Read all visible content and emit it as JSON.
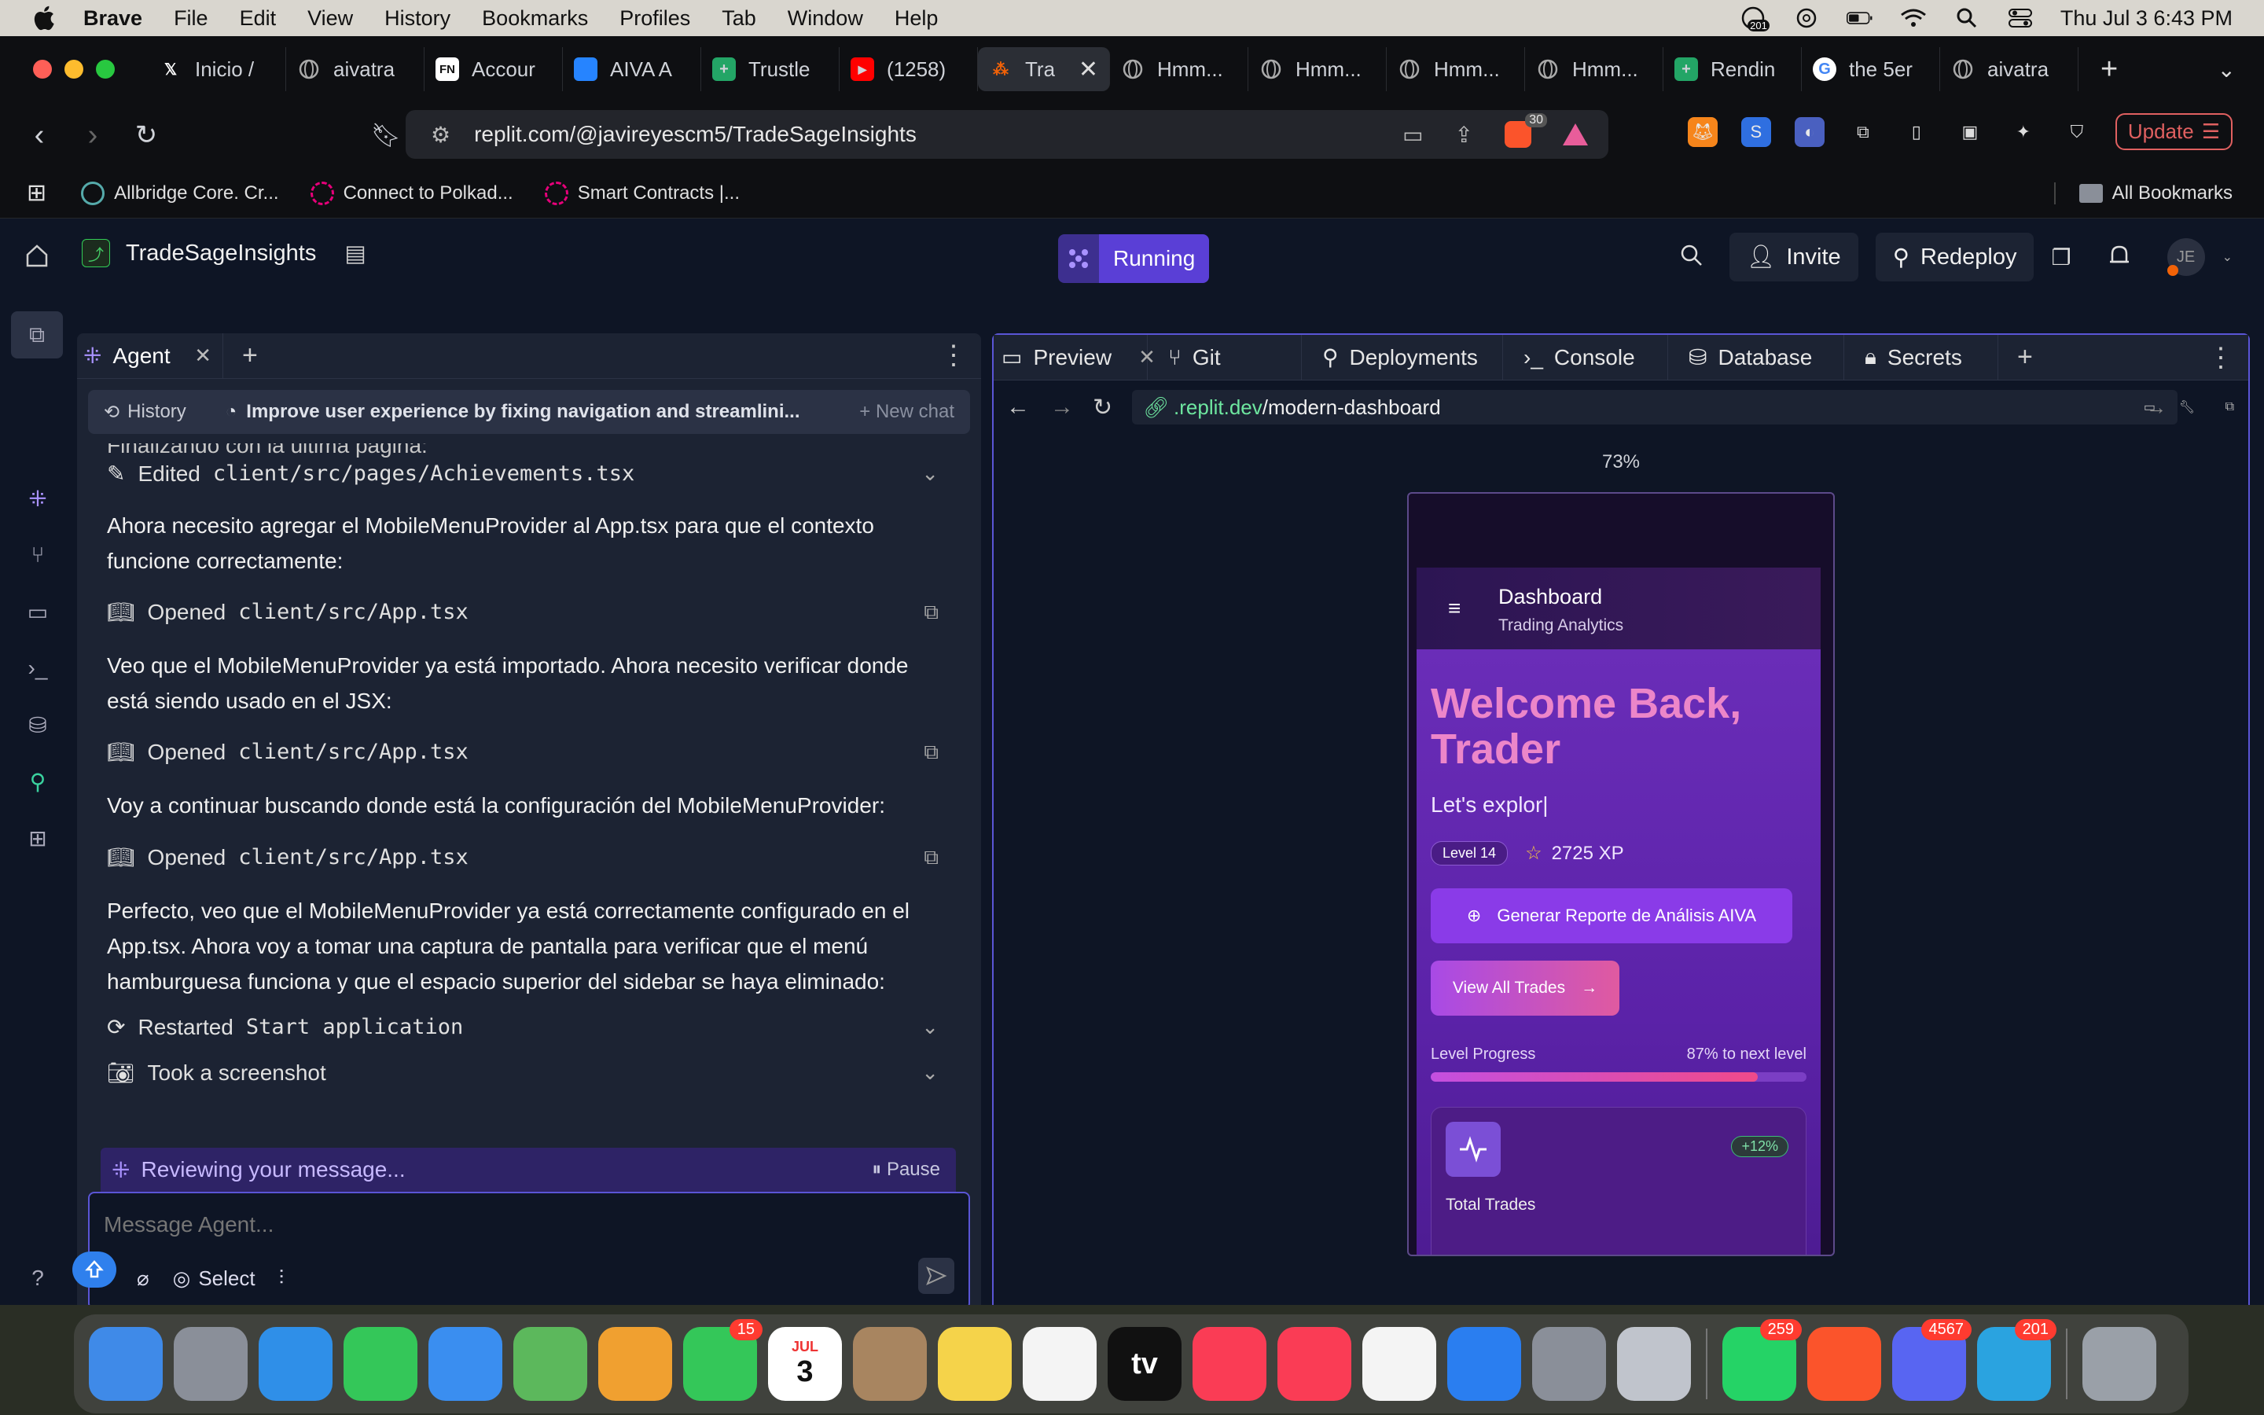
{
  "menubar": {
    "app": "Brave",
    "items": [
      "File",
      "Edit",
      "View",
      "History",
      "Bookmarks",
      "Profiles",
      "Tab",
      "Window",
      "Help"
    ],
    "notif_count": "201",
    "datetime": "Thu Jul 3  6:43 PM"
  },
  "tabs": [
    {
      "label": "Inicio /",
      "icon": "x-logo"
    },
    {
      "label": "aivatra",
      "icon": "globe"
    },
    {
      "label": "Accour",
      "icon": "fn-logo"
    },
    {
      "label": "AIVA A",
      "icon": "jira-logo"
    },
    {
      "label": "Trustle",
      "icon": "sheets-logo"
    },
    {
      "label": "(1258)",
      "icon": "youtube-logo"
    },
    {
      "label": "Tra",
      "icon": "replit-logo",
      "active": true
    },
    {
      "label": "Hmm...",
      "icon": "globe"
    },
    {
      "label": "Hmm...",
      "icon": "globe"
    },
    {
      "label": "Hmm...",
      "icon": "globe"
    },
    {
      "label": "Hmm...",
      "icon": "globe"
    },
    {
      "label": "Rendin",
      "icon": "sheets-logo"
    },
    {
      "label": "the 5er",
      "icon": "google-logo"
    },
    {
      "label": "aivatra",
      "icon": "globe"
    }
  ],
  "address": {
    "url": "replit.com/@javireyescm5/TradeSageInsights",
    "brave_shield_count": "30",
    "update_label": "Update"
  },
  "bookmarks": {
    "items": [
      "Allbridge Core. Cr...",
      "Connect to Polkad...",
      "Smart Contracts |..."
    ],
    "all": "All Bookmarks"
  },
  "workspace": {
    "project_name": "TradeSageInsights",
    "status": "Running",
    "invite": "Invite",
    "redeploy": "Redeploy",
    "avatar_initials": "JE"
  },
  "agent": {
    "tab_label": "Agent",
    "history_label": "History",
    "thread_title": "Improve user experience by fixing navigation and streamlini...",
    "new_chat": "+ New chat",
    "top_cut_text": "Finalizando con la última página:",
    "edited": {
      "verb": "Edited",
      "file": "client/src/pages/Achievements.tsx"
    },
    "msg1": "Ahora necesito agregar el MobileMenuProvider al App.tsx para que el contexto funcione correctamente:",
    "opened1": {
      "verb": "Opened",
      "file": "client/src/App.tsx"
    },
    "msg2": "Veo que el MobileMenuProvider ya está importado. Ahora necesito verificar donde está siendo usado en el JSX:",
    "opened2": {
      "verb": "Opened",
      "file": "client/src/App.tsx"
    },
    "msg3": "Voy a continuar buscando donde está la configuración del MobileMenuProvider:",
    "opened3": {
      "verb": "Opened",
      "file": "client/src/App.tsx"
    },
    "msg4": "Perfecto, veo que el MobileMenuProvider ya está correctamente configurado en el App.tsx. Ahora voy a tomar una captura de pantalla para verificar que el menú hamburguesa funciona y que el espacio superior del sidebar se haya eliminado:",
    "restarted": {
      "verb": "Restarted",
      "target": "Start application"
    },
    "screenshot": "Took a screenshot",
    "reviewing": "Reviewing your message...",
    "pause": "Pause",
    "input_placeholder": "Message Agent...",
    "select_label": "Select"
  },
  "preview": {
    "tabs": [
      "Preview",
      "Git",
      "Deployments",
      "Console",
      "Database",
      "Secrets"
    ],
    "url_domain": ".replit.dev",
    "url_path": "/modern-dashboard",
    "zoom": "73%"
  },
  "app_preview": {
    "header_title": "Dashboard",
    "header_subtitle": "Trading Analytics",
    "welcome": "Welcome Back, Trader",
    "typing": "Let's explor|",
    "level": "Level 14",
    "xp": "2725 XP",
    "generate_btn": "Generar Reporte de Análisis AIVA",
    "view_trades_btn": "View All Trades",
    "progress_label": "Level Progress",
    "progress_right": "87% to next level",
    "progress_fraction": 0.87,
    "card_change": "+12%",
    "card_label": "Total Trades"
  },
  "dock": {
    "apps": [
      {
        "name": "Finder",
        "color": "#3f8ae8"
      },
      {
        "name": "Launchpad",
        "color": "#8a8f99"
      },
      {
        "name": "Safari",
        "color": "#2f8fe8"
      },
      {
        "name": "Messages",
        "color": "#34c759"
      },
      {
        "name": "Mail",
        "color": "#3a8ef0"
      },
      {
        "name": "Maps",
        "color": "#5cb85c"
      },
      {
        "name": "Photos",
        "color": "#f0a030"
      },
      {
        "name": "FaceTime",
        "color": "#34c759",
        "badge": "15"
      },
      {
        "name": "Calendar",
        "color": "#ffffff",
        "text": "3",
        "sub": "JUL"
      },
      {
        "name": "Contacts",
        "color": "#a88560"
      },
      {
        "name": "Notes",
        "color": "#f5d34a"
      },
      {
        "name": "Freeform",
        "color": "#f4f4f4"
      },
      {
        "name": "TV",
        "color": "#111111",
        "text": "tv"
      },
      {
        "name": "Music",
        "color": "#fa3c55"
      },
      {
        "name": "News",
        "color": "#fa3c55"
      },
      {
        "name": "Reminders",
        "color": "#f4f4f4"
      },
      {
        "name": "App Store",
        "color": "#2a7ef0"
      },
      {
        "name": "System Settings",
        "color": "#8a8f99"
      },
      {
        "name": "iPhone Mirroring",
        "color": "#c0c4cc"
      },
      {
        "name": "WhatsApp",
        "color": "#25d366",
        "badge": "259"
      },
      {
        "name": "Brave",
        "color": "#fb542b"
      },
      {
        "name": "Discord",
        "color": "#5865f2",
        "badge": "4567"
      },
      {
        "name": "Telegram",
        "color": "#2aa3e0",
        "badge": "201"
      },
      {
        "name": "Trash",
        "color": "#9aa0a8"
      }
    ]
  }
}
